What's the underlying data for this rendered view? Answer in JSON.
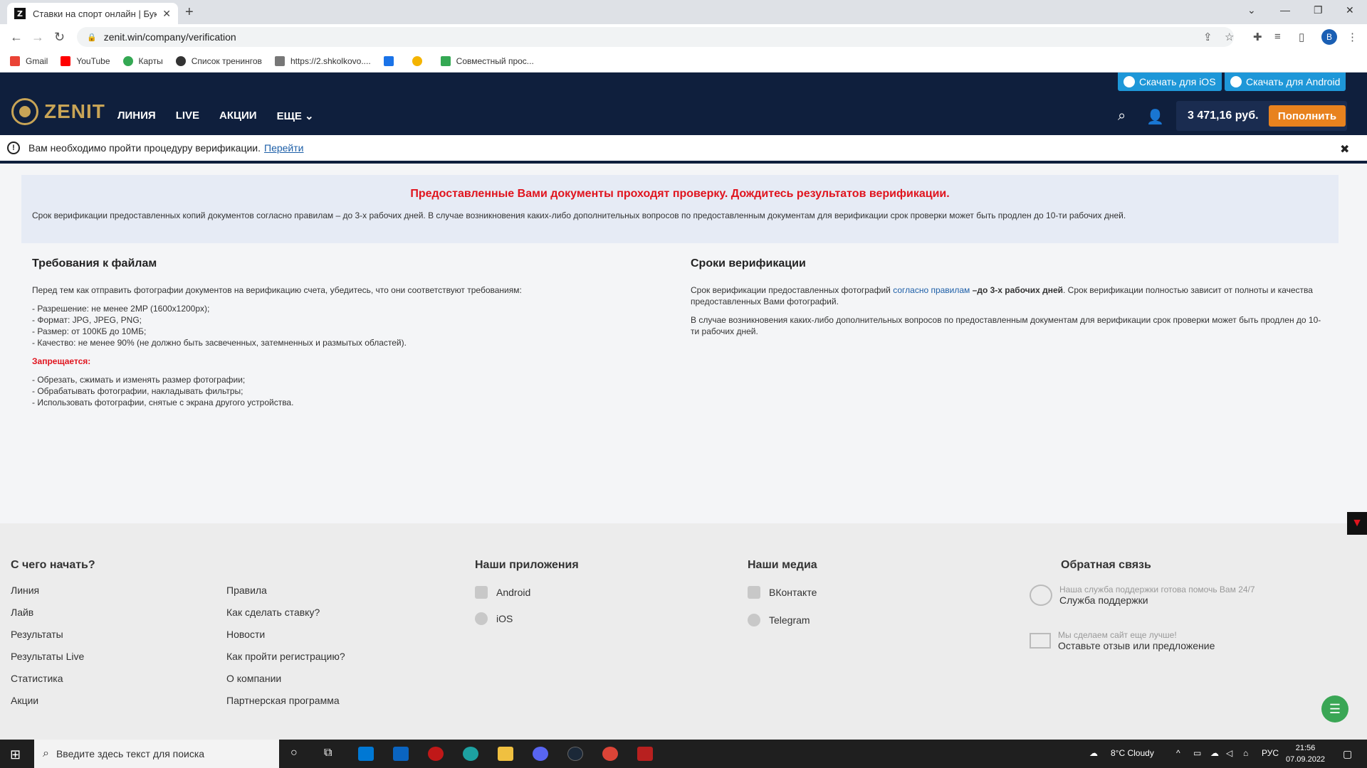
{
  "browser": {
    "tab_title": "Ставки на спорт онлайн | Букме",
    "tab_favicon": "Z",
    "url": "zenit.win/company/verification",
    "profile_initial": "B",
    "bookmarks": [
      "Gmail",
      "YouTube",
      "Карты",
      "Список тренингов",
      "https://2.shkolkovo....",
      "Совместный прос..."
    ]
  },
  "header": {
    "download_ios": "Скачать для iOS",
    "download_android": "Скачать для Android",
    "logo_text": "ZENIT",
    "nav": [
      "ЛИНИЯ",
      "LIVE",
      "АКЦИИ",
      "ЕЩЕ"
    ],
    "balance": "3 471,16 руб.",
    "topup_label": "Пополнить"
  },
  "notice": {
    "text": "Вам необходимо пройти процедуру верификации.",
    "link": "Перейти"
  },
  "status": {
    "title": "Предоставленные Вами документы проходят проверку. Дождитесь результатов верификации.",
    "text": "Срок верификации предоставленных копий документов согласно правилам – до 3-х рабочих дней. В случае возникновения каких-либо дополнительных вопросов по предоставленным документам для верификации срок проверки может быть продлен до 10-ти рабочих дней."
  },
  "requirements": {
    "title": "Требования к файлам",
    "intro": "Перед тем как отправить фотографии документов на верификацию счета, убедитесь, что они соответствуют требованиям:",
    "items": [
      "Разрешение: не менее 2MP (1600x1200px);",
      "Формат: JPG, JPEG, PNG;",
      "Размер: от 100КБ до 10МБ;",
      "Качество: не менее 90% (не должно быть засвеченных, затемненных и размытых областей)."
    ],
    "forbidden_title": "Запрещается:",
    "forbidden_items": [
      "Обрезать, сжимать и изменять размер фотографии;",
      "Обрабатывать фотографии, накладывать фильтры;",
      "Использовать фотографии, снятые с экрана другого устройства."
    ]
  },
  "terms": {
    "title": "Сроки верификации",
    "p1_before": "Срок верификации предоставленных фотографий",
    "p1_link": "согласно правилам",
    "p1_bold": "–до 3-х рабочих дней",
    "p1_after": ". Срок верификации полностью зависит от полноты и качества предоставленных Вами фотографий.",
    "p2": "В случае возникновения каких-либо дополнительных вопросов по предоставленным документам для верификации срок проверки может быть продлен до 10-ти рабочих дней."
  },
  "footer": {
    "start_title": "С чего начать?",
    "col1": [
      "Линия",
      "Лайв",
      "Результаты",
      "Результаты Live",
      "Статистика",
      "Акции"
    ],
    "col2": [
      "Правила",
      "Как сделать ставку?",
      "Новости",
      "Как пройти регистрацию?",
      "О компании",
      "Партнерская программа"
    ],
    "apps_title": "Наши приложения",
    "apps": [
      "Android",
      "iOS"
    ],
    "media_title": "Наши медиа",
    "media": [
      "ВКонтакте",
      "Telegram"
    ],
    "feedback_title": "Обратная связь",
    "support_small": "Наша служба поддержки готова помочь Вам 24/7",
    "support_big": "Служба поддержки",
    "review_small": "Мы сделаем сайт еще лучше!",
    "review_big": "Оставьте отзыв или предложение"
  },
  "taskbar": {
    "search_placeholder": "Введите здесь текст для поиска",
    "weather": "8°C  Cloudy",
    "lang": "РУС",
    "time": "21:56",
    "date": "07.09.2022"
  }
}
